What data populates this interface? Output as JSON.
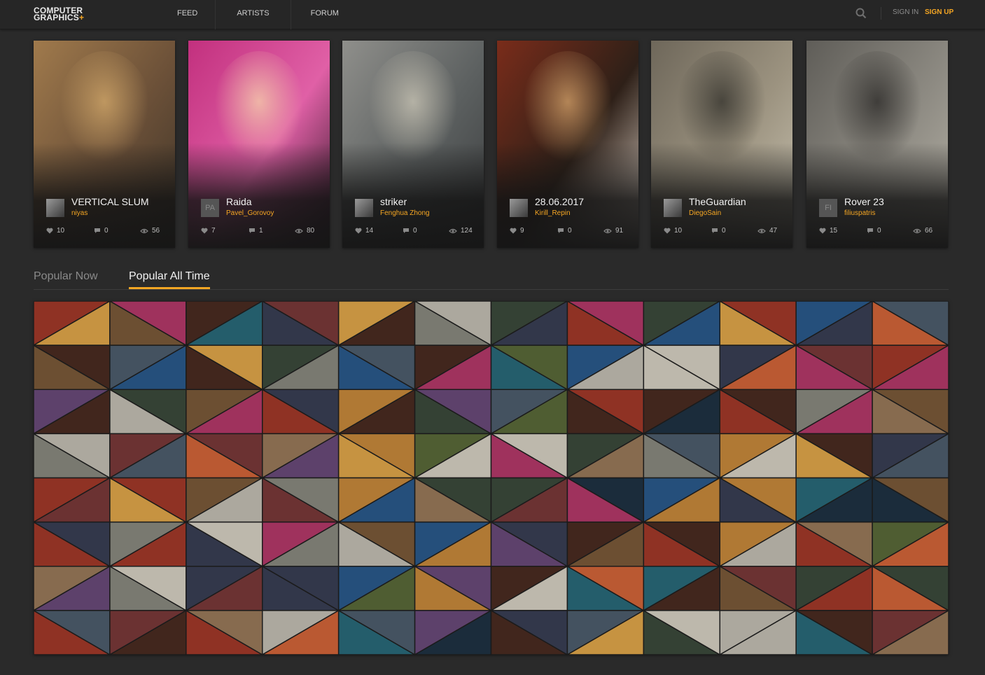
{
  "header": {
    "logo_line1": "COMPUTER",
    "logo_line2": "GRAPHICS",
    "logo_plus": "+",
    "nav": [
      "FEED",
      "ARTISTS",
      "FORUM"
    ],
    "search_icon": "search-icon",
    "signin": "SIGN IN",
    "signup": "SIGN UP"
  },
  "colors": {
    "accent": "#f5a623",
    "background": "#2a2a2a",
    "header_bg": "#262626"
  },
  "cards": [
    {
      "title": "VERTICAL SLUM",
      "author": "niyas",
      "avatar": "",
      "likes": "10",
      "comments": "0",
      "views": "56",
      "palette": [
        "#a07a4c",
        "#6b5038",
        "#c29a62",
        "#3e3428"
      ]
    },
    {
      "title": "Raida",
      "author": "Pavel_Gorovoy",
      "avatar": "PA",
      "likes": "7",
      "comments": "1",
      "views": "80",
      "palette": [
        "#c2307e",
        "#e060a6",
        "#f0b9a8",
        "#2a1522"
      ]
    },
    {
      "title": "striker",
      "author": "Fenghua Zhong",
      "avatar": "",
      "likes": "14",
      "comments": "0",
      "views": "124",
      "palette": [
        "#8f8f8b",
        "#5c6060",
        "#b8b5a8",
        "#3a3c3d"
      ]
    },
    {
      "title": "28.06.2017",
      "author": "Kirill_Repin",
      "avatar": "",
      "likes": "9",
      "comments": "0",
      "views": "91",
      "palette": [
        "#7a2c1a",
        "#2e2018",
        "#b98a5a",
        "#e8dcd0"
      ]
    },
    {
      "title": "TheGuardian",
      "author": "DiegoSain",
      "avatar": "",
      "likes": "10",
      "comments": "0",
      "views": "47",
      "palette": [
        "#6e675a",
        "#9c9380",
        "#45423a",
        "#c8c2b0"
      ]
    },
    {
      "title": "Rover 23",
      "author": "filiuspatris",
      "avatar": "FI",
      "likes": "15",
      "comments": "0",
      "views": "66",
      "palette": [
        "#5f5d58",
        "#8d8a82",
        "#3c3a37",
        "#b5b1a6"
      ]
    }
  ],
  "tabs": [
    "Popular Now",
    "Popular All Time"
  ],
  "active_tab": 1,
  "mosaic_palette": [
    "#c98a3c",
    "#3a3f55",
    "#7c5a3a",
    "#2b5a8c",
    "#b53a6a",
    "#8a8a80",
    "#5a6a3a",
    "#d8d2c4",
    "#4a2c22",
    "#a33a2a",
    "#2a6a7a",
    "#e2a84a",
    "#6a4a7a",
    "#3c4a3c",
    "#9a7a5a",
    "#c4c0b4",
    "#1f3344",
    "#7a3a3a",
    "#d4663a",
    "#4e5e6e"
  ]
}
